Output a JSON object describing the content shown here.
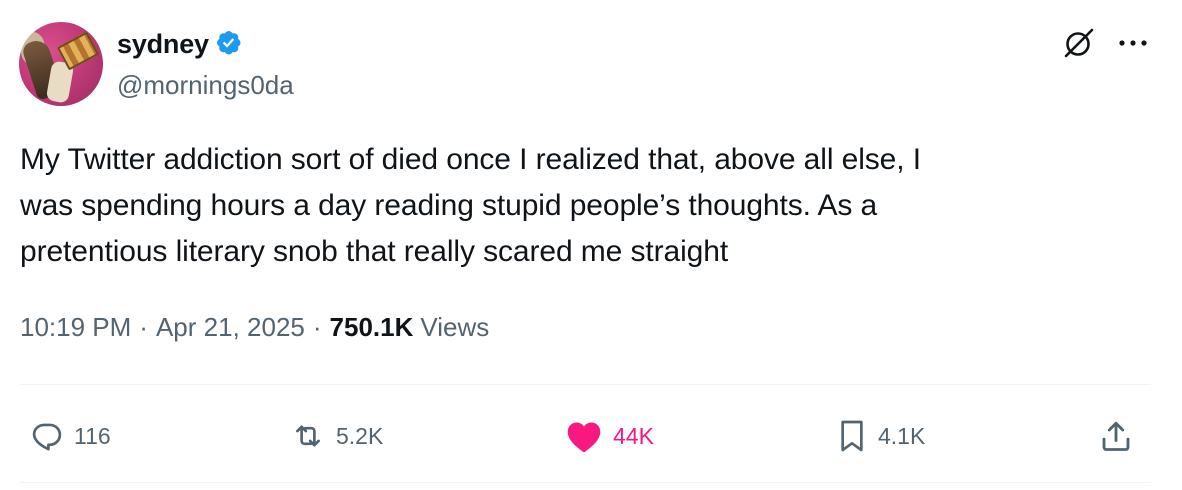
{
  "author": {
    "display_name": "sydney",
    "handle": "@mornings0da",
    "verified": true,
    "avatar": "avatar-photo"
  },
  "header_icons": [
    "grok-icon",
    "more-icon"
  ],
  "tweet": {
    "text": "My Twitter addiction sort of died once I realized that, above all else, I\nwas spending hours a day reading stupid people’s thoughts. As a\npretentious literary snob that really scared me straight"
  },
  "meta": {
    "time": "10:19 PM",
    "separator": "·",
    "date": "Apr 21, 2025",
    "views_count": "750.1K",
    "views_label": "Views"
  },
  "actions": {
    "replies": "116",
    "reposts": "5.2K",
    "likes": "44K",
    "bookmarks": "4.1K"
  },
  "colors": {
    "text": "#0f1419",
    "secondary": "#536471",
    "verified": "#1d9bf0",
    "like": "#f91880",
    "divider": "#eff3f4"
  }
}
